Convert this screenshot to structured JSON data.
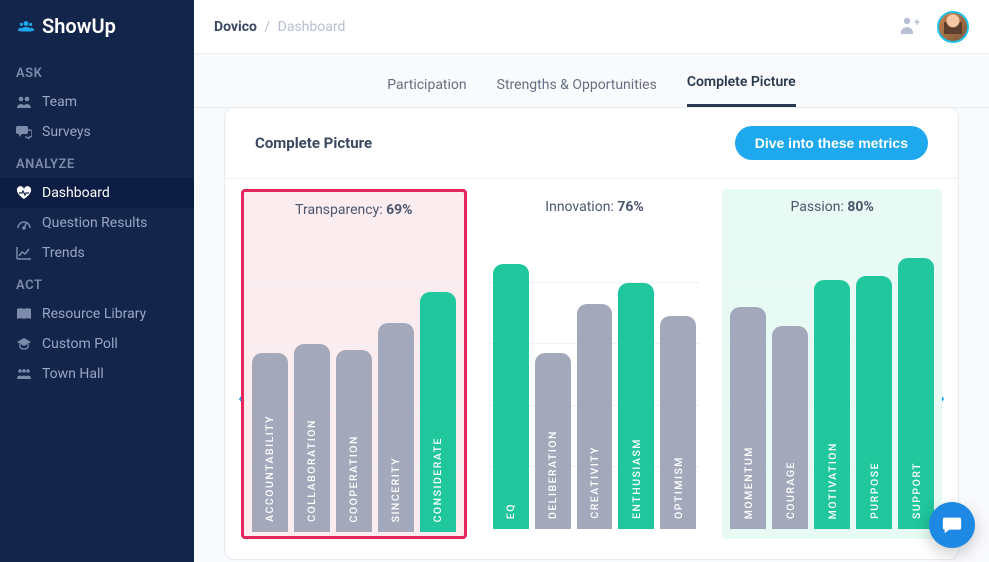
{
  "app": {
    "name": "ShowUp"
  },
  "sidebar": {
    "sections": [
      {
        "title": "ASK",
        "items": [
          {
            "label": "Team",
            "icon": "users"
          },
          {
            "label": "Surveys",
            "icon": "chat"
          }
        ]
      },
      {
        "title": "ANALYZE",
        "items": [
          {
            "label": "Dashboard",
            "icon": "heart",
            "active": true
          },
          {
            "label": "Question Results",
            "icon": "dial"
          },
          {
            "label": "Trends",
            "icon": "trend"
          }
        ]
      },
      {
        "title": "ACT",
        "items": [
          {
            "label": "Resource Library",
            "icon": "book"
          },
          {
            "label": "Custom Poll",
            "icon": "cap"
          },
          {
            "label": "Town Hall",
            "icon": "crowd"
          }
        ]
      }
    ]
  },
  "breadcrumb": {
    "root": "Dovico",
    "current": "Dashboard"
  },
  "tabs": [
    {
      "label": "Participation",
      "active": false
    },
    {
      "label": "Strengths & Opportunities",
      "active": false
    },
    {
      "label": "Complete Picture",
      "active": true
    }
  ],
  "card": {
    "title": "Complete Picture",
    "cta": "Dive into these metrics"
  },
  "chart_data": [
    {
      "type": "bar",
      "title": "Transparency",
      "percent": "69%",
      "ylim": [
        0,
        100
      ],
      "highlight": "red_box",
      "background": "pink",
      "series": [
        {
          "name": "ACCOUNTABILITY",
          "value": 58,
          "color": "gray"
        },
        {
          "name": "COLLABORATION",
          "value": 61,
          "color": "gray"
        },
        {
          "name": "COOPERATION",
          "value": 59,
          "color": "gray"
        },
        {
          "name": "SINCERITY",
          "value": 68,
          "color": "gray"
        },
        {
          "name": "CONSIDERATE",
          "value": 78,
          "color": "green"
        }
      ]
    },
    {
      "type": "bar",
      "title": "Innovation",
      "percent": "76%",
      "ylim": [
        0,
        100
      ],
      "background": "none",
      "series": [
        {
          "name": "EQ",
          "value": 86,
          "color": "green"
        },
        {
          "name": "DELIBERATION",
          "value": 57,
          "color": "gray"
        },
        {
          "name": "CREATIVITY",
          "value": 73,
          "color": "gray"
        },
        {
          "name": "ENTHUSIASM",
          "value": 80,
          "color": "green"
        },
        {
          "name": "OPTIMISM",
          "value": 69,
          "color": "gray"
        }
      ]
    },
    {
      "type": "bar",
      "title": "Passion",
      "percent": "80%",
      "ylim": [
        0,
        100
      ],
      "background": "mint",
      "series": [
        {
          "name": "MOMENTUM",
          "value": 72,
          "color": "gray"
        },
        {
          "name": "COURAGE",
          "value": 66,
          "color": "gray"
        },
        {
          "name": "MOTIVATION",
          "value": 81,
          "color": "green"
        },
        {
          "name": "PURPOSE",
          "value": 82,
          "color": "green"
        },
        {
          "name": "SUPPORT",
          "value": 88,
          "color": "green"
        }
      ]
    }
  ]
}
